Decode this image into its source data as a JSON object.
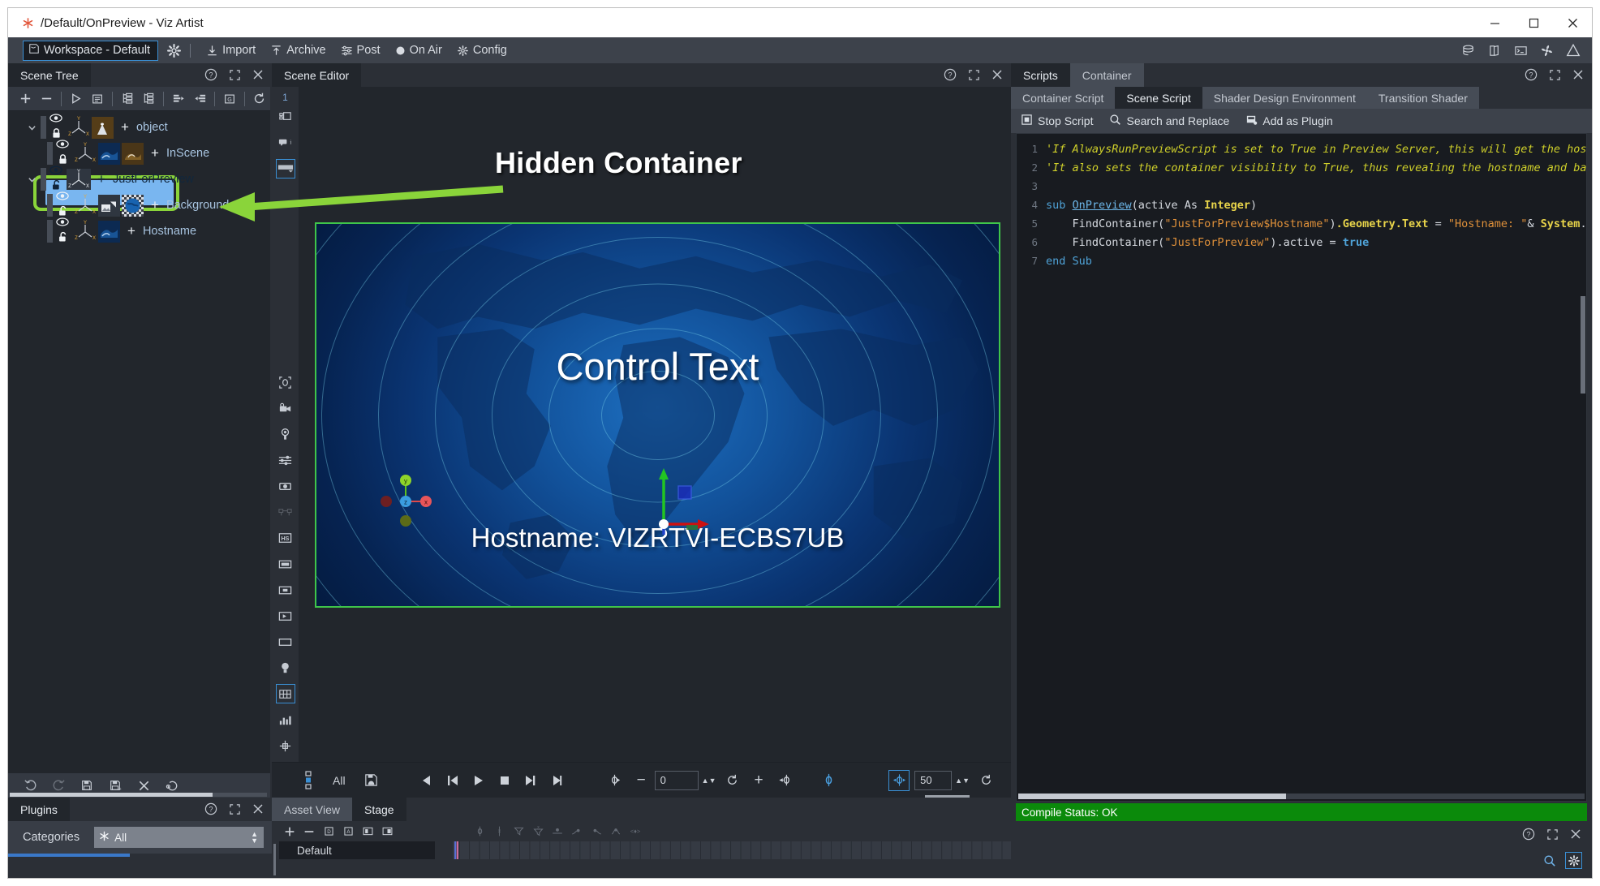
{
  "window": {
    "title": "/Default/OnPreview - Viz Artist",
    "app_icon": "asterisk-icon",
    "minimize_label": "Minimize",
    "maximize_label": "Maximize",
    "close_label": "Close"
  },
  "menubar": {
    "workspace_label": "Workspace - Default",
    "items": [
      {
        "label": "Import",
        "icon": "import-icon"
      },
      {
        "label": "Archive",
        "icon": "archive-icon"
      },
      {
        "label": "Post",
        "icon": "post-icon"
      },
      {
        "label": "On Air",
        "icon": "on-air-icon"
      },
      {
        "label": "Config",
        "icon": "config-gear-icon"
      }
    ],
    "right_icons": [
      "database-icon",
      "book-icon",
      "console-icon",
      "fan-icon",
      "warning-icon"
    ]
  },
  "scene_tree": {
    "tab_label": "Scene Tree",
    "toolbar_icons": [
      "add-icon",
      "remove-icon",
      "play-forward-icon",
      "list-icon",
      "expand-tree-icon",
      "collapse-tree-icon",
      "move-right-icon",
      "move-left-icon",
      "group-icon",
      "refresh-icon"
    ],
    "items": [
      {
        "name": "object",
        "depth": 0,
        "expanded": true,
        "tag": "Object",
        "locked": true,
        "visible": true,
        "selected": false,
        "thumbs": 1
      },
      {
        "name": "InScene",
        "depth": 1,
        "expanded": false,
        "tag": "Text",
        "locked": true,
        "visible": true,
        "selected": false,
        "thumbs": 2
      },
      {
        "name": "JustForPreview",
        "depth": 1,
        "expanded": true,
        "tag": "",
        "locked": false,
        "visible": true,
        "selected": true,
        "thumbs": 0
      },
      {
        "name": "Background",
        "depth": 2,
        "expanded": false,
        "tag": "Quad",
        "locked": false,
        "visible": true,
        "selected": false,
        "thumbs": 2
      },
      {
        "name": "Hostname",
        "depth": 2,
        "expanded": false,
        "tag": "Text",
        "locked": false,
        "visible": true,
        "selected": false,
        "thumbs": 1
      }
    ],
    "footer_icons": [
      "undo-icon",
      "redo-icon",
      "save-icon",
      "save-as-icon",
      "delete-icon",
      "revert-icon"
    ]
  },
  "annotation": {
    "text": "Hidden Container",
    "highlight_color": "#8ad43a",
    "arrow_color": "#8ad43a"
  },
  "scene_editor": {
    "tab_label": "Scene Editor",
    "camera_number": "1",
    "left_tool_icons": [
      "layers-icon",
      "info-icon",
      "dropdown-icon",
      "camera-target-icon",
      "camera-icon",
      "light-icon",
      "levels-icon",
      "keyframe-icon",
      "bones-icon",
      "hs-icon",
      "bar-icon",
      "center-icon",
      "play-box-icon",
      "rect-icon",
      "bulb-icon",
      "grid-icon",
      "chart-icon",
      "snap-icon"
    ],
    "canvas": {
      "control_text": "Control Text",
      "hostname_text": "Hostname: VIZRTVI-ECBS7UB",
      "border_color": "#3fc54a",
      "axis_labels": {
        "x": "x",
        "y": "y",
        "z": "z"
      }
    },
    "timeline": {
      "all_label": "All",
      "start_value": "0",
      "end_value": "50",
      "transport_icons": [
        "step-back-icon",
        "go-start-icon",
        "play-icon",
        "stop-icon",
        "go-end-icon",
        "step-forward-icon"
      ]
    }
  },
  "plugins_panel": {
    "tab_label": "Plugins",
    "categories_label": "Categories",
    "filter_value": "All",
    "filter_icon": "asterisk-icon"
  },
  "stage_panel": {
    "tabs": [
      "Asset View",
      "Stage"
    ],
    "active_tab": "Stage",
    "toolbar_icons": [
      "add-icon",
      "remove-icon",
      "add-director-icon",
      "add-action-icon",
      "add-stage-icon",
      "save-stage-icon"
    ],
    "key_icons": [
      "key-icon",
      "key-x-icon",
      "funnel-icon",
      "funnel-x-icon",
      "ease-icon",
      "ease-in-icon",
      "ease-out-icon",
      "ease-both-icon",
      "linear-icon"
    ],
    "track_name": "Default"
  },
  "scripts_panel": {
    "tabs": [
      "Scripts",
      "Container"
    ],
    "active_tab": "Scripts",
    "subtabs": [
      "Container Script",
      "Scene Script",
      "Shader Design Environment",
      "Transition Shader"
    ],
    "active_subtab": "Scene Script",
    "actions": [
      {
        "label": "Stop Script",
        "icon": "stop-script-icon"
      },
      {
        "label": "Search and Replace",
        "icon": "search-icon"
      },
      {
        "label": "Add as Plugin",
        "icon": "plugin-icon"
      }
    ],
    "compile_status": "Compile Status: OK",
    "compile_status_color": "#0b8a0b",
    "code": [
      {
        "n": "1",
        "segments": [
          {
            "t": "'If AlwaysRunPreviewScript is set to True in Preview Server, this will get the hostname of the Vi",
            "c": "c-comment"
          }
        ]
      },
      {
        "n": "2",
        "segments": [
          {
            "t": "'It also sets the container visibility to True, thus revealing the hostname and background image,",
            "c": "c-comment"
          }
        ]
      },
      {
        "n": "3",
        "segments": [
          {
            "t": "",
            "c": "c-plain"
          }
        ]
      },
      {
        "n": "4",
        "segments": [
          {
            "t": "sub ",
            "c": "c-kw"
          },
          {
            "t": "OnPreview",
            "c": "c-fn"
          },
          {
            "t": "(active As ",
            "c": "c-plain"
          },
          {
            "t": "Integer",
            "c": "c-bold"
          },
          {
            "t": ")",
            "c": "c-plain"
          }
        ]
      },
      {
        "n": "5",
        "segments": [
          {
            "t": "    FindContainer(",
            "c": "c-plain"
          },
          {
            "t": "\"JustForPreview$Hostname\"",
            "c": "c-str"
          },
          {
            "t": ")",
            "c": "c-plain"
          },
          {
            "t": ".Geometry.Text",
            "c": "c-prop"
          },
          {
            "t": " = ",
            "c": "c-plain"
          },
          {
            "t": "\"Hostname: \"",
            "c": "c-str"
          },
          {
            "t": "& ",
            "c": "c-plain"
          },
          {
            "t": "System",
            "c": "c-bold"
          },
          {
            "t": ".Hostname",
            "c": "c-plain"
          }
        ]
      },
      {
        "n": "6",
        "segments": [
          {
            "t": "    FindContainer(",
            "c": "c-plain"
          },
          {
            "t": "\"JustForPreview\"",
            "c": "c-str"
          },
          {
            "t": ").active = ",
            "c": "c-plain"
          },
          {
            "t": "true",
            "c": "c-true"
          }
        ]
      },
      {
        "n": "7",
        "segments": [
          {
            "t": "end Sub",
            "c": "c-kw"
          }
        ]
      }
    ]
  }
}
